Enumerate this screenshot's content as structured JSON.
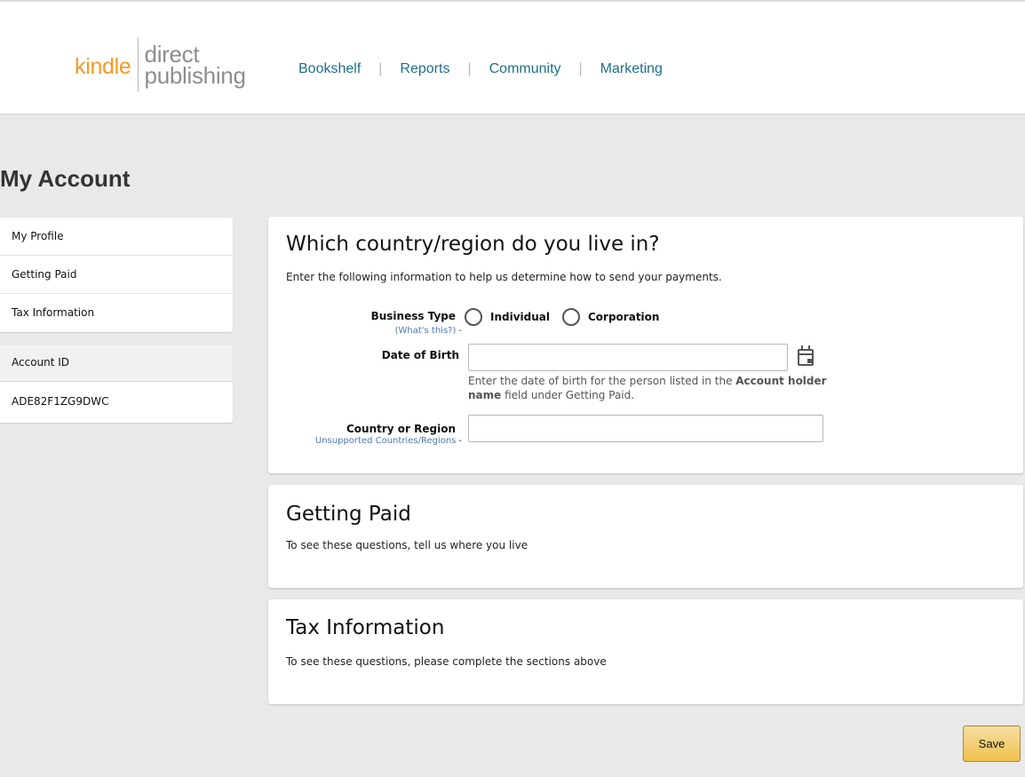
{
  "header": {
    "logo_kindle": "kindle",
    "logo_direct": "direct",
    "logo_publishing": "publishing",
    "nav": [
      "Bookshelf",
      "Reports",
      "Community",
      "Marketing"
    ],
    "nav_separator": "|"
  },
  "page": {
    "title": "My Account"
  },
  "sidebar": {
    "items": [
      "My Profile",
      "Getting Paid",
      "Tax Information"
    ],
    "account_id_label": "Account ID",
    "account_id_value": "ADE82F1ZG9DWC"
  },
  "residence": {
    "title": "Which country/region do you live in?",
    "subtitle": "Enter the following information to help us determine how to send your payments.",
    "business_type_label": "Business Type",
    "business_type_help": "(What's this?)",
    "options": [
      "Individual",
      "Corporation"
    ],
    "dob_label": "Date of Birth",
    "dob_value": "",
    "dob_hint_pre": "Enter the date of birth for the person listed in the ",
    "dob_hint_bold": "Account holder name",
    "dob_hint_post": " field under Getting Paid.",
    "country_label": "Country or Region",
    "country_help": "Unsupported Countries/Regions",
    "country_value": ""
  },
  "getting_paid": {
    "title": "Getting Paid",
    "text": "To see these questions, tell us where you live"
  },
  "tax": {
    "title": "Tax Information",
    "text": "To see these questions, please complete the sections above"
  },
  "actions": {
    "save_label": "Save"
  },
  "colors": {
    "kindle_orange": "#f79a22",
    "nav_link": "#1d6f86",
    "help_link": "#4a79b8",
    "save_button": "#f0c14b"
  }
}
